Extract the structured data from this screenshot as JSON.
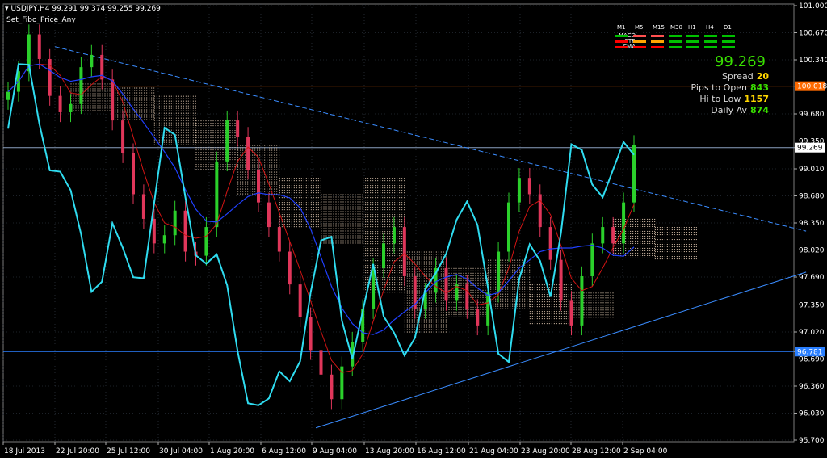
{
  "header": {
    "symbol_line": "USDJPY,H4  99.291 99.374 99.255 99.269",
    "indicator": "Set_Fibo_Price_Any"
  },
  "panel": {
    "timeframes": [
      "M1",
      "M5",
      "M15",
      "M30",
      "H1",
      "H4",
      "D1"
    ],
    "rows": [
      {
        "label": "MACD",
        "colors": [
          "#00c000",
          "#ff5050",
          "#ff5050",
          "#00c000",
          "#00c000",
          "#00c000",
          "#00c000"
        ]
      },
      {
        "label": "STR",
        "colors": [
          "#ff0000",
          "#ffa500",
          "#ffa500",
          "#00c000",
          "#00c000",
          "#00c000",
          "#00c000"
        ]
      },
      {
        "label": "EMA",
        "colors": [
          "#ff0000",
          "#ff0000",
          "#ff0000",
          "#00c000",
          "#00c000",
          "#00c000",
          "#00c000"
        ]
      }
    ],
    "price": "99.269",
    "spread_label": "Spread",
    "spread_value": "20",
    "pips_label": "Pips to Open",
    "pips_value": "843",
    "hilo_label": "Hi to Low",
    "hilo_value": "1157",
    "daily_label": "Daily Av",
    "daily_value": "874"
  },
  "axis": {
    "price_labels": [
      "101.000",
      "100.670",
      "100.340",
      "100.018",
      "99.680",
      "99.350",
      "99.269",
      "99.010",
      "98.680",
      "98.350",
      "98.020",
      "97.690",
      "97.350",
      "97.020",
      "96.781",
      "96.690",
      "96.360",
      "96.030",
      "95.700"
    ],
    "date_labels": [
      "18 Jul 2013",
      "22 Jul 20:00",
      "25 Jul 12:00",
      "30 Jul 04:00",
      "1 Aug 20:00",
      "6 Aug 12:00",
      "9 Aug 04:00",
      "13 Aug 20:00",
      "16 Aug 12:00",
      "21 Aug 04:00",
      "23 Aug 20:00",
      "28 Aug 12:00",
      "2 Sep 04:00"
    ]
  },
  "chart_data": {
    "type": "candlestick",
    "symbol": "USDJPY",
    "timeframe": "H4",
    "ylim": [
      95.7,
      101.0
    ],
    "current_price": 99.269,
    "hlines": [
      {
        "value": 100.018,
        "color": "#ff6a00"
      },
      {
        "value": 99.269,
        "color": "#8aa0c0"
      },
      {
        "value": 96.781,
        "color": "#2a7fff"
      }
    ],
    "closes": [
      99.95,
      100.2,
      100.65,
      100.35,
      99.9,
      99.7,
      99.8,
      100.25,
      100.4,
      100.1,
      99.6,
      99.2,
      98.7,
      98.4,
      98.1,
      98.2,
      98.5,
      98.0,
      97.95,
      98.3,
      99.1,
      99.6,
      99.4,
      99.0,
      98.6,
      98.3,
      98.0,
      97.6,
      97.2,
      96.8,
      96.5,
      96.2,
      96.6,
      96.9,
      97.3,
      97.8,
      98.1,
      98.3,
      97.7,
      97.3,
      97.5,
      97.8,
      97.4,
      97.6,
      97.3,
      97.1,
      97.5,
      98.0,
      98.6,
      98.9,
      98.7,
      98.3,
      97.9,
      97.4,
      97.1,
      97.7,
      98.1,
      98.3,
      98.1,
      98.6,
      99.3
    ]
  },
  "colors": {
    "bull": "#2bd02b",
    "bear": "#e0365a",
    "cyan_line": "#2fdcf0",
    "blue_line": "#2040ff",
    "red_line": "#d21414",
    "trend": "#3a8cff",
    "grid": "#3a4452"
  }
}
